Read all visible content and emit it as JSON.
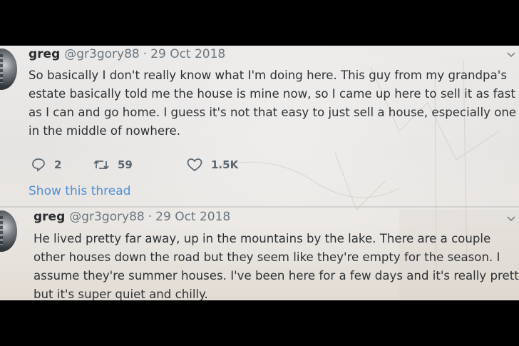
{
  "tweets": [
    {
      "name": "greg",
      "handle": "@gr3gory88",
      "separator": "·",
      "date": "29 Oct 2018",
      "lines": [
        "So basically I don't really know what I'm doing here. This guy from my grandpa's",
        "estate basically told me the house is mine now, so I came up here to sell it as fast",
        "as I can and go home. I guess it's not that easy to just sell a house, especially one",
        "in the middle of nowhere."
      ],
      "replies": "2",
      "retweets": "59",
      "likes": "1.5K",
      "show_thread": "Show this thread"
    },
    {
      "name": "greg",
      "handle": "@gr3gory88",
      "separator": "·",
      "date": "29 Oct 2018",
      "lines": [
        "He lived pretty far away, up in the mountains by the lake. There are a couple",
        "other houses down the road but they seem like they're empty for the season. I",
        "assume they're summer houses. I've been here for a few days and it's really pretty,",
        "but it's super quiet and chilly."
      ]
    }
  ],
  "icons": {
    "reply": "reply-icon",
    "retweet": "retweet-icon",
    "like": "heart-icon",
    "menu": "chevron-down-icon",
    "avatar": "avatar"
  },
  "colors": {
    "link": "#4f8fd3",
    "text": "#2e3236",
    "muted": "#6a7680",
    "letterbox": "#000000"
  }
}
